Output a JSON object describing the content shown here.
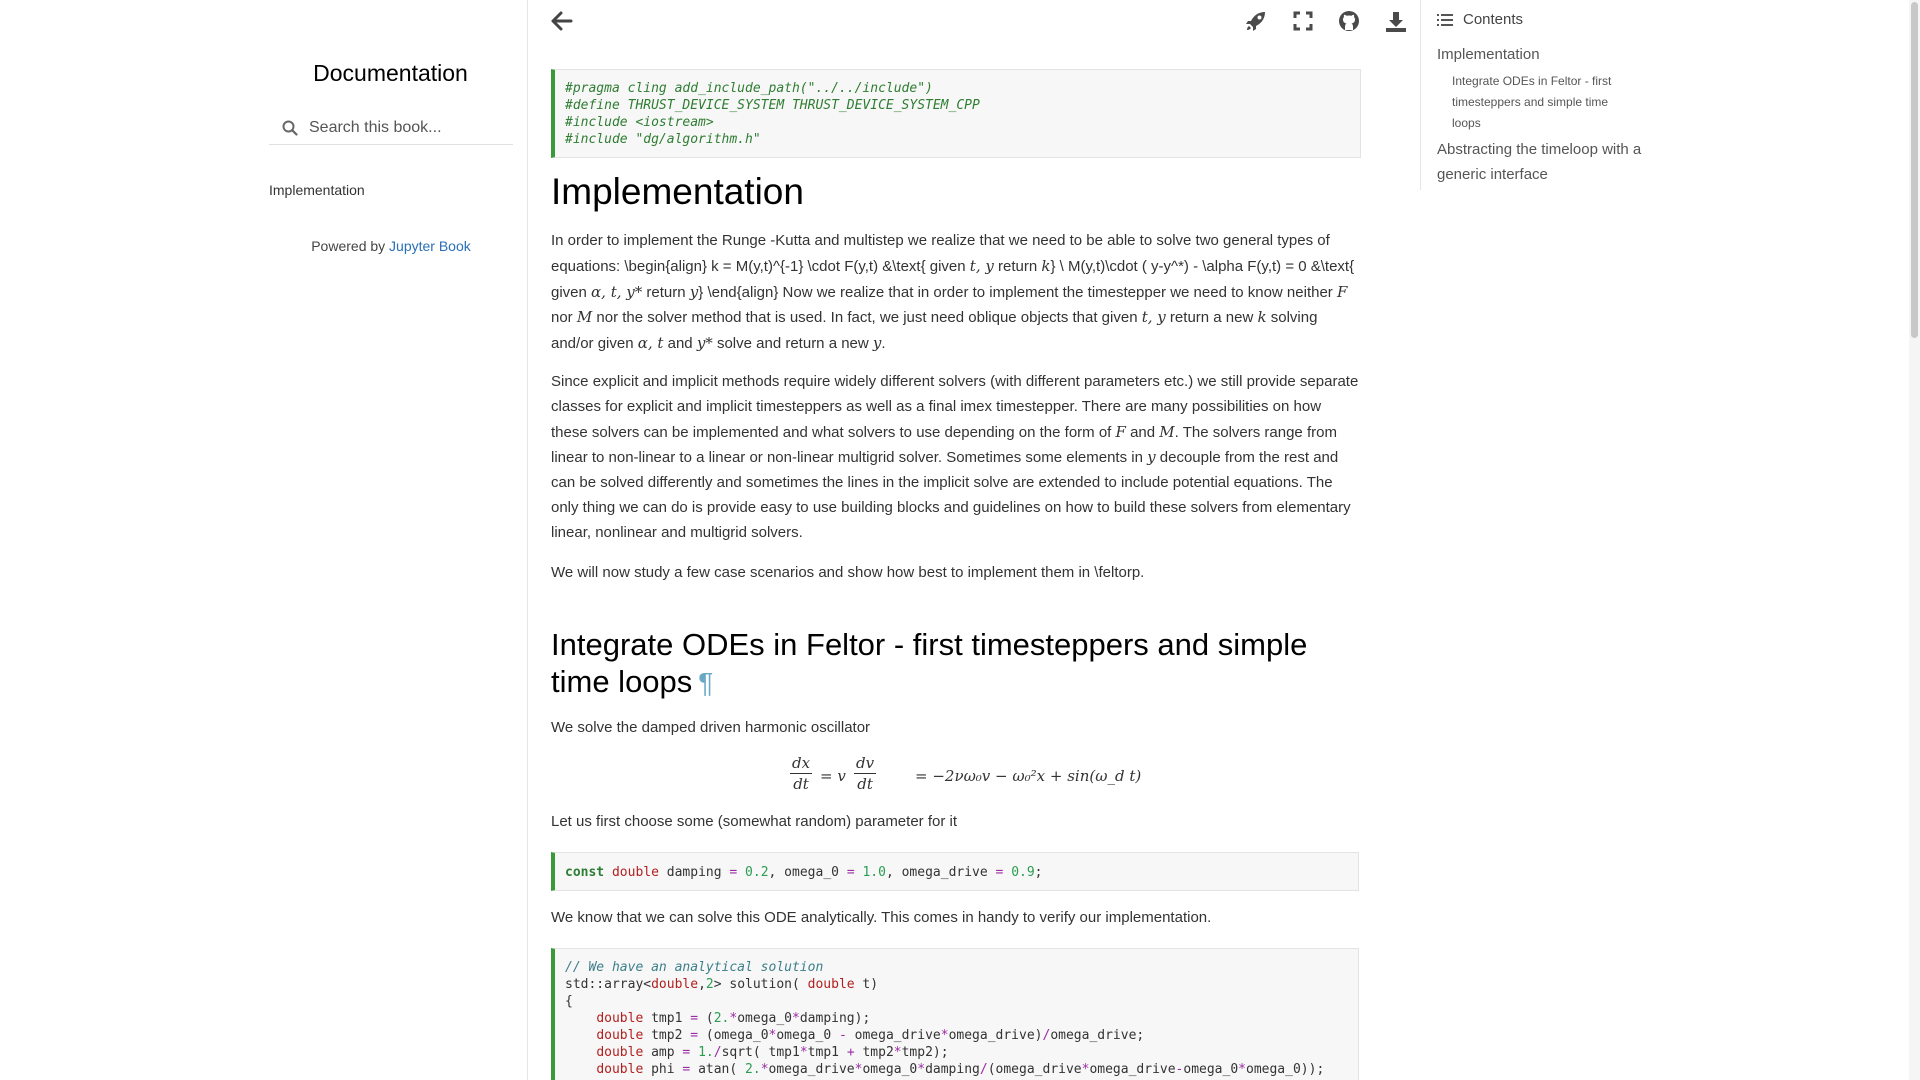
{
  "sidebar": {
    "book_title": "Documentation",
    "search_placeholder": "Search this book...",
    "nav_items": [
      "Implementation"
    ],
    "powered_prefix": "Powered by ",
    "powered_link": "Jupyter Book"
  },
  "topbar": {
    "icons": [
      "arrow-left-icon",
      "rocket-icon",
      "fullscreen-icon",
      "github-icon",
      "download-icon"
    ]
  },
  "content": {
    "code_cell_1": {
      "lines": [
        "#pragma cling add_include_path(\"../../include\")",
        "#define THRUST_DEVICE_SYSTEM THRUST_DEVICE_SYSTEM_CPP",
        "#include <iostream>",
        "#include \"dg/algorithm.h\""
      ]
    },
    "h1": "Implementation",
    "para1": {
      "t1": "In order to implement the Runge -Kutta and multistep we realize that we need to be able to solve two general types of equations: \\begin{align} k = M(y,t)^{-1} \\cdot F(y,t) &\\text{ given ",
      "m1": "t, y",
      "t2": " return ",
      "m2": "k",
      "t3": "} \\ M(y,t)\\cdot ( y-y^*) - \\alpha F(y,t) = 0 &\\text{ given ",
      "m3": "α, t, y*",
      "t4": " return ",
      "m4": "y",
      "t5": "} \\end{align} Now we realize that in order to implement the timestepper we need to know neither ",
      "m5": "F",
      "t6": " nor ",
      "m6": "M",
      "t7": " nor the solver method that is used. In fact, we just need oblique objects that given ",
      "m7": "t, y",
      "t8": " return a new ",
      "m8": "k",
      "t9": " solving and/or given ",
      "m9": "α, t",
      "t10": " and ",
      "m10": "y*",
      "t11": " solve and return a new ",
      "m11": "y",
      "t12": "."
    },
    "para2": {
      "t1": "Since explicit and implicit methods require widely different solvers (with different parameters etc.) we still provide separate classes for explicit and implicit timesteppers as well as a final imex timestepper. There are many possibilities on how these solvers can be implemented and what solvers to use depending on the form of ",
      "m1": "F",
      "t2": " and ",
      "m2": "M",
      "t3": ". The solvers range from linear to non-linear to a linear or non-linear multigrid solver. Sometimes some elements in ",
      "m3": "y",
      "t4": " decouple from the rest and can be solved differently and sometimes the lines in the implicit solve are extended to include potential equations. The only thing we can do is provide easy to use building blocks and guidelines on how to build these solvers from elementary linear, nonlinear and multigrid solvers."
    },
    "para3": "We will now study a few case scenarios and show how best to implement them in \\feltorp.",
    "h2": "Integrate ODEs in Feltor - first timesteppers and simple time loops",
    "pilcrow": "¶",
    "para4": "We solve the damped driven harmonic oscillator",
    "equation": {
      "frac1_num": "dx",
      "frac1_den": "dt",
      "mid1": "= v",
      "frac2_num": "dv",
      "frac2_den": "dt",
      "rhs": "= −2νω₀v − ω₀²x + sin(ω_d t)"
    },
    "para5": "Let us first choose some (somewhat random) parameter for it",
    "code_cell_2": {
      "line": "const double damping = 0.2, omega_0 = 1.0, omega_drive = 0.9;"
    },
    "para6": "We know that we can solve this ODE analytically. This comes in handy to verify our implementation.",
    "code_cell_3": {
      "lines": [
        "// We have an analytical solution",
        "std::array<double,2> solution( double t)",
        "{",
        "    double tmp1 = (2.*omega_0*damping);",
        "    double tmp2 = (omega_0*omega_0 - omega_drive*omega_drive)/omega_drive;",
        "    double amp = 1./sqrt( tmp1*tmp1 + tmp2*tmp2);",
        "    double phi = atan( 2.*omega_drive*omega_0*damping/(omega_drive*omega_drive-omega_0*omega_0));"
      ]
    }
  },
  "toc": {
    "header": "Contents",
    "items": [
      {
        "label": "Implementation",
        "level": 1
      },
      {
        "label": "Integrate ODEs in Feltor - first timesteppers and simple time loops",
        "level": 2
      },
      {
        "label": "Abstracting the timeloop with a generic interface",
        "level": 1
      }
    ]
  }
}
